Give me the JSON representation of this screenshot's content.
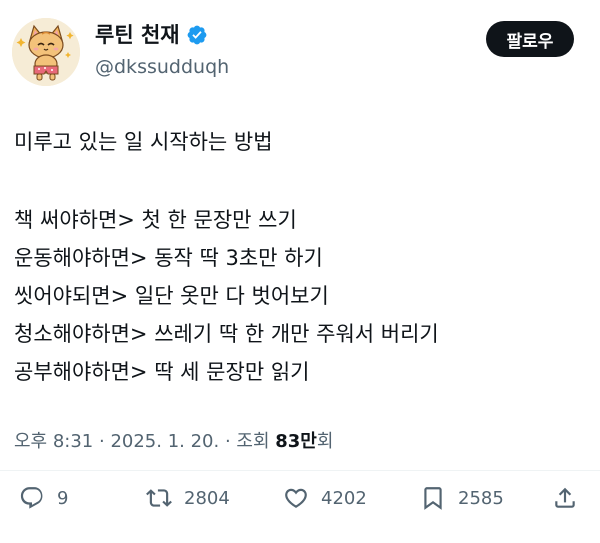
{
  "author": {
    "display_name": "루틴 천재",
    "handle": "@dkssudduqh",
    "verified_icon": "verified-badge-icon",
    "avatar_icon": "cat-avatar"
  },
  "follow_label": "팔로우",
  "tweet": {
    "title": "미루고 있는 일 시작하는 방법",
    "lines": [
      "책 써야하면> 첫 한 문장만 쓰기",
      "운동해야하면> 동작 딱 3초만 하기",
      "씻어야되면> 일단 옷만 다 벗어보기",
      "청소해야하면> 쓰레기 딱 한 개만 주워서 버리기",
      "공부해야하면> 딱 세 문장만 읽기"
    ]
  },
  "meta": {
    "time": "오후 8:31",
    "separator": " · ",
    "date": "2025. 1. 20.",
    "views_label": "조회",
    "views_count": "83만",
    "views_suffix": "회"
  },
  "actions": {
    "reply": {
      "icon": "reply-icon",
      "count": "9"
    },
    "retweet": {
      "icon": "retweet-icon",
      "count": "2804"
    },
    "like": {
      "icon": "heart-icon",
      "count": "4202"
    },
    "bookmark": {
      "icon": "bookmark-icon",
      "count": "2585"
    },
    "share": {
      "icon": "share-icon"
    }
  },
  "colors": {
    "text": "#0f1419",
    "muted": "#536471",
    "verified": "#1d9bf0",
    "button_bg": "#0f1419"
  }
}
